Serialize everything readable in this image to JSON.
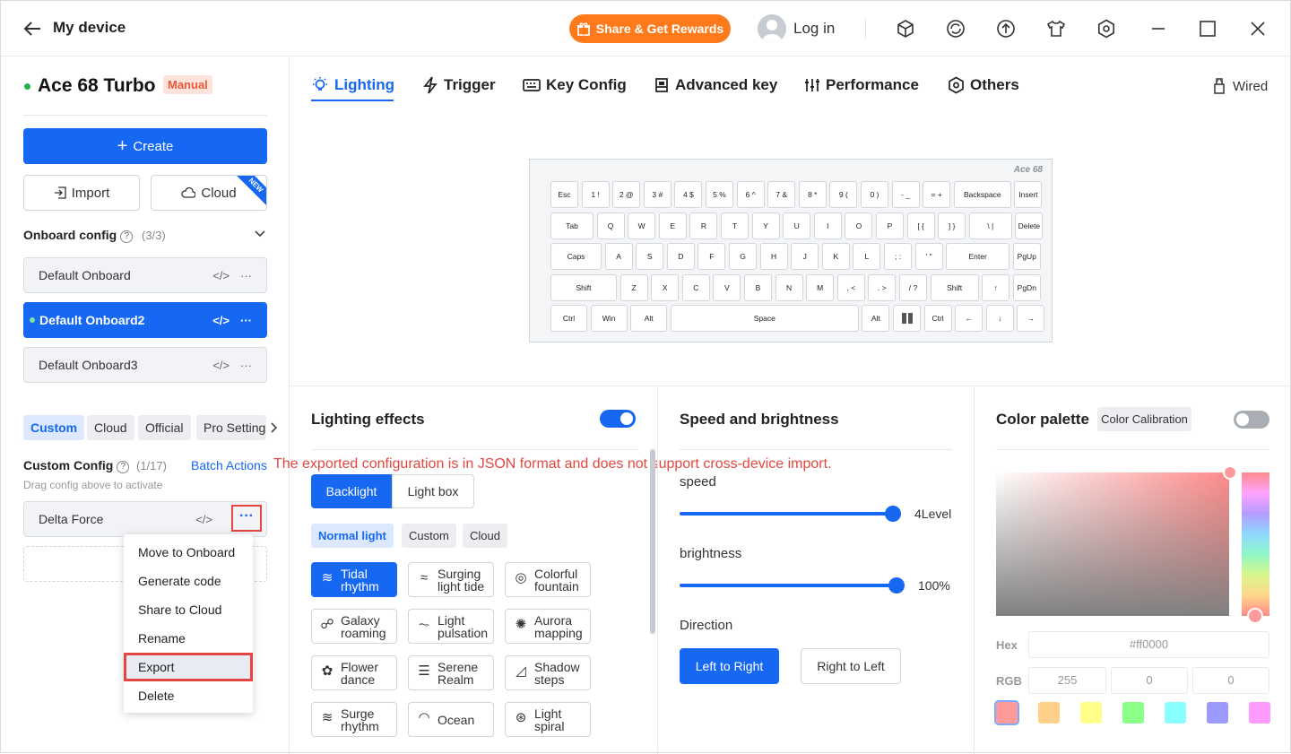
{
  "header": {
    "title": "My device",
    "share_label": "Share & Get Rewards",
    "login_label": "Log in",
    "icons": [
      "cube-icon",
      "cloud-sync-icon",
      "upload-icon",
      "tshirt-icon",
      "settings-icon",
      "maximize-icon",
      "close-icon"
    ]
  },
  "device": {
    "name": "Ace 68 Turbo",
    "mode_badge": "Manual"
  },
  "sidebar": {
    "create_label": "Create",
    "import_label": "Import",
    "cloud_label": "Cloud",
    "new_badge": "NEW",
    "onboard": {
      "title": "Onboard config",
      "count": "(3/3)",
      "items": [
        {
          "label": "Default Onboard",
          "active": false
        },
        {
          "label": "Default Onboard2",
          "active": true
        },
        {
          "label": "Default Onboard3",
          "active": false
        }
      ]
    },
    "filter_tabs": [
      "Custom",
      "Cloud",
      "Official",
      "Pro Settings"
    ],
    "custom": {
      "title": "Custom Config",
      "count": "(1/17)",
      "batch_label": "Batch Actions",
      "hint": "Drag config above to activate",
      "items": [
        {
          "label": "Delta Force"
        }
      ],
      "drop_hint": "Drag"
    },
    "context_menu": [
      "Move to Onboard",
      "Generate code",
      "Share to Cloud",
      "Rename",
      "Export",
      "Delete"
    ]
  },
  "annotation": "The exported configuration is in JSON format and does not support cross-device import.",
  "tabs": [
    "Lighting",
    "Trigger",
    "Key Config",
    "Advanced key",
    "Performance",
    "Others"
  ],
  "connection": "Wired",
  "keyboard": {
    "brand": "Ace 68",
    "rows": [
      [
        "Esc",
        "1 !",
        "2 @",
        "3 #",
        "4 $",
        "5 %",
        "6 ^",
        "7 &",
        "8 *",
        "9 (",
        "0 )",
        "- _",
        "= +",
        "Backspace",
        "Insert"
      ],
      [
        "Tab",
        "Q",
        "W",
        "E",
        "R",
        "T",
        "Y",
        "U",
        "I",
        "O",
        "P",
        "[ {",
        "] }",
        "\\ |",
        "Delete"
      ],
      [
        "Caps",
        "A",
        "S",
        "D",
        "F",
        "G",
        "H",
        "J",
        "K",
        "L",
        "; :",
        "' \"",
        "Enter",
        "PgUp"
      ],
      [
        "Shift",
        "Z",
        "X",
        "C",
        "V",
        "B",
        "N",
        "M",
        ", <",
        ". >",
        "/ ?",
        "Shift",
        "↑",
        "PgDn"
      ],
      [
        "Ctrl",
        "Win",
        "Alt",
        "Space",
        "Alt",
        "",
        "Ctrl",
        "←",
        "↓",
        "→"
      ]
    ]
  },
  "lighting": {
    "title": "Lighting effects",
    "toggle_on": true,
    "segments": [
      "Backlight",
      "Light box"
    ],
    "categories": [
      "Normal light",
      "Custom",
      "Cloud"
    ],
    "effects": [
      {
        "label": "Tidal rhythm",
        "icon": "wave-icon",
        "selected": true
      },
      {
        "label": "Surging light tide",
        "icon": "tide-icon",
        "selected": false
      },
      {
        "label": "Colorful fountain",
        "icon": "fountain-icon",
        "selected": false
      },
      {
        "label": "Galaxy roaming",
        "icon": "galaxy-icon",
        "selected": false
      },
      {
        "label": "Light pulsation",
        "icon": "pulse-icon",
        "selected": false
      },
      {
        "label": "Aurora mapping",
        "icon": "aurora-icon",
        "selected": false
      },
      {
        "label": "Flower dance",
        "icon": "flower-icon",
        "selected": false
      },
      {
        "label": "Serene Realm",
        "icon": "lines-icon",
        "selected": false
      },
      {
        "label": "Shadow steps",
        "icon": "steps-icon",
        "selected": false
      },
      {
        "label": "Surge rhythm",
        "icon": "surge-icon",
        "selected": false
      },
      {
        "label": "Ocean",
        "icon": "ocean-icon",
        "selected": false
      },
      {
        "label": "Light spiral",
        "icon": "spiral-icon",
        "selected": false
      }
    ]
  },
  "speed_brightness": {
    "title": "Speed and brightness",
    "speed_label": "speed",
    "speed_value": "4Level",
    "brightness_label": "brightness",
    "brightness_value": "100%",
    "direction_label": "Direction",
    "directions": [
      "Left to Right",
      "Right to Left"
    ]
  },
  "palette": {
    "title": "Color palette",
    "calibration_label": "Color Calibration",
    "toggle_on": false,
    "hex_label": "Hex",
    "hex_value": "#ff0000",
    "rgb_label": "RGB",
    "rgb": [
      "255",
      "0",
      "0"
    ],
    "swatches": [
      "#ff9a9a",
      "#ffd08a",
      "#ffff8a",
      "#8aff8a",
      "#8affff",
      "#9a9aff",
      "#ff9aff"
    ]
  }
}
